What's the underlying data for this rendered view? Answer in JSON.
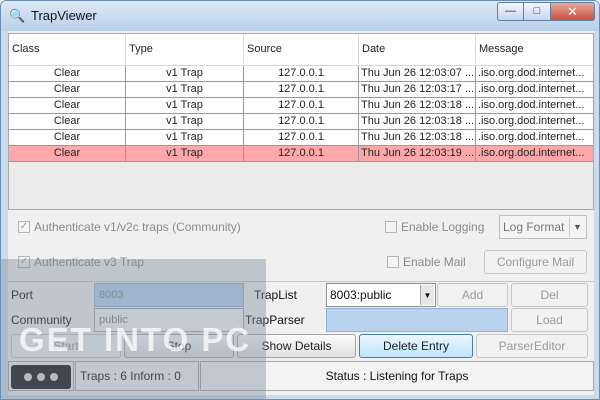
{
  "window": {
    "title": "TrapViewer",
    "icon": "trapviewer-app-icon",
    "controls": {
      "minimize": "minimize-icon",
      "maximize": "maximize-icon",
      "close": "close-icon"
    }
  },
  "table": {
    "columns": [
      "Class",
      "Type",
      "Source",
      "Date",
      "Message"
    ],
    "rows": [
      {
        "class": "Clear",
        "type": "v1 Trap",
        "source": "127.0.0.1",
        "date": "Thu Jun 26 12:03:07 ...",
        "message": ".iso.org.dod.internet...",
        "highlight": false
      },
      {
        "class": "Clear",
        "type": "v1 Trap",
        "source": "127.0.0.1",
        "date": "Thu Jun 26 12:03:17 ...",
        "message": ".iso.org.dod.internet...",
        "highlight": false
      },
      {
        "class": "Clear",
        "type": "v1 Trap",
        "source": "127.0.0.1",
        "date": "Thu Jun 26 12:03:18 ...",
        "message": ".iso.org.dod.internet...",
        "highlight": false
      },
      {
        "class": "Clear",
        "type": "v1 Trap",
        "source": "127.0.0.1",
        "date": "Thu Jun 26 12:03:18 ...",
        "message": ".iso.org.dod.internet...",
        "highlight": false
      },
      {
        "class": "Clear",
        "type": "v1 Trap",
        "source": "127.0.0.1",
        "date": "Thu Jun 26 12:03:18 ...",
        "message": ".iso.org.dod.internet...",
        "highlight": false
      },
      {
        "class": "Clear",
        "type": "v1 Trap",
        "source": "127.0.0.1",
        "date": "Thu Jun 26 12:03:19 ...",
        "message": ".iso.org.dod.internet...",
        "highlight": true
      }
    ],
    "highlight_color": "#ffa8aa"
  },
  "options": {
    "auth_v1v2c": {
      "label": "Authenticate v1/v2c traps (Community)",
      "checked": true
    },
    "auth_v3": {
      "label": "Authenticate v3 Trap",
      "checked": true
    },
    "enable_logging": {
      "label": "Enable Logging",
      "checked": false
    },
    "enable_mail": {
      "label": "Enable Mail",
      "checked": false
    },
    "log_format": "Log Format",
    "configure_mail": "Configure Mail"
  },
  "config": {
    "port_label": "Port",
    "port_value": "8003",
    "community_label": "Community",
    "community_value": "public",
    "traplist_label": "TrapList",
    "traplist_value": "8003:public",
    "trapparser_label": "TrapParser",
    "trapparser_value": "",
    "add_button": "Add",
    "del_button": "Del",
    "load_button": "Load"
  },
  "actions": {
    "start": "Start",
    "stop": "Stop",
    "show_details": "Show Details",
    "delete_entry": "Delete Entry",
    "parser_editor": "ParserEditor"
  },
  "status": {
    "counts": "Traps : 6 Inform : 0",
    "message": "Status : Listening for Traps"
  },
  "watermark": "GET INTO PC"
}
